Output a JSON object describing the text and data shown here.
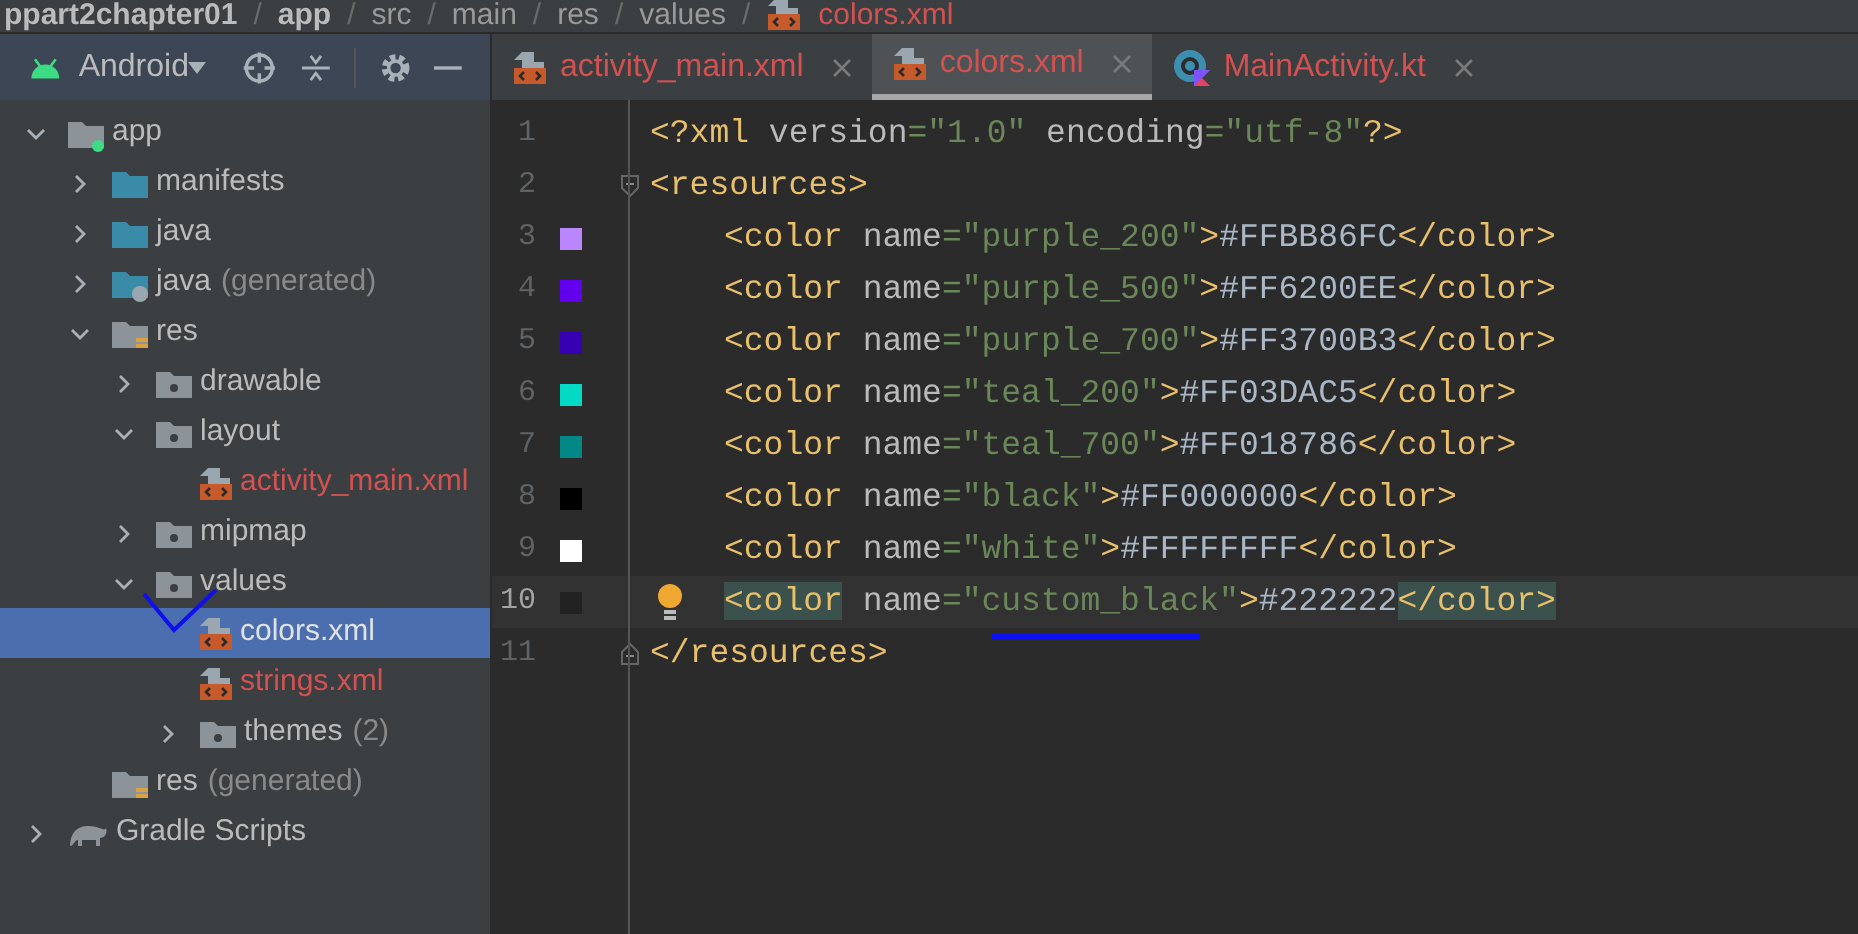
{
  "breadcrumb": [
    {
      "kind": "bold",
      "text": "ppart2chapter01"
    },
    {
      "kind": "separator",
      "text": "/"
    },
    {
      "kind": "bold",
      "text": "app"
    },
    {
      "kind": "separator",
      "text": "/"
    },
    {
      "kind": "plain",
      "text": "src"
    },
    {
      "kind": "separator",
      "text": "/"
    },
    {
      "kind": "plain",
      "text": "main"
    },
    {
      "kind": "separator",
      "text": "/"
    },
    {
      "kind": "plain",
      "text": "res"
    },
    {
      "kind": "separator",
      "text": "/"
    },
    {
      "kind": "plain",
      "text": "values"
    },
    {
      "kind": "separator",
      "text": "/"
    },
    {
      "kind": "file",
      "text": "colors.xml"
    }
  ],
  "project_panel": {
    "view": "Android"
  },
  "tree": [
    {
      "kind": "module",
      "label": "app",
      "expanded": true,
      "selected": false,
      "children": [
        {
          "kind": "folder",
          "label": "manifests",
          "expanded": false,
          "selected": false
        },
        {
          "kind": "folder",
          "label": "java",
          "expanded": false,
          "selected": false
        },
        {
          "kind": "generated-folder",
          "label": "java",
          "suffix": "(generated)",
          "expanded": false,
          "selected": false
        },
        {
          "kind": "res-folder",
          "label": "res",
          "expanded": true,
          "selected": false,
          "children": [
            {
              "kind": "subfolder",
              "label": "drawable",
              "expanded": false,
              "selected": false
            },
            {
              "kind": "subfolder",
              "label": "layout",
              "expanded": true,
              "selected": false,
              "children": [
                {
                  "kind": "xml-file",
                  "label": "activity_main.xml",
                  "selected": false
                }
              ]
            },
            {
              "kind": "subfolder",
              "label": "mipmap",
              "expanded": false,
              "selected": false
            },
            {
              "kind": "subfolder",
              "label": "values",
              "expanded": true,
              "selected": false,
              "children": [
                {
                  "kind": "xml-file",
                  "label": "colors.xml",
                  "selected": true
                },
                {
                  "kind": "xml-file",
                  "label": "strings.xml",
                  "selected": false
                },
                {
                  "kind": "subfolder",
                  "label": "themes",
                  "suffix": "(2)",
                  "expanded": false,
                  "selected": false
                }
              ]
            }
          ]
        },
        {
          "kind": "res-folder",
          "label": "res",
          "suffix": "(generated)",
          "selected": false
        }
      ]
    },
    {
      "kind": "gradle",
      "label": "Gradle Scripts",
      "expanded": false,
      "selected": false
    }
  ],
  "tabs": [
    {
      "kind": "xml",
      "label": "activity_main.xml",
      "selected": false
    },
    {
      "kind": "xml",
      "label": "colors.xml",
      "selected": true
    },
    {
      "kind": "kotlin",
      "label": "MainActivity.kt",
      "selected": false
    }
  ],
  "lines": [
    {
      "number": "1",
      "kind": "plain",
      "indent": false,
      "current": false,
      "tokens": [
        {
          "kind": "tag",
          "t": "<?xml"
        },
        {
          "kind": "attr",
          "t": " version"
        },
        {
          "kind": "str",
          "t": "=\"1.0\""
        },
        {
          "kind": "attr",
          "t": " encoding"
        },
        {
          "kind": "str",
          "t": "=\"utf-8\""
        },
        {
          "kind": "tag",
          "t": "?>"
        }
      ]
    },
    {
      "number": "2",
      "kind": "fold-start",
      "indent": false,
      "current": false,
      "tokens": [
        {
          "kind": "tag",
          "t": "<resources>"
        }
      ]
    },
    {
      "number": "3",
      "kind": "plain",
      "indent": true,
      "current": false,
      "color": "#bb86fc",
      "tokens": [
        {
          "kind": "tag",
          "t": "<color"
        },
        {
          "kind": "attr",
          "t": " name"
        },
        {
          "kind": "str",
          "t": "=\"purple_200\""
        },
        {
          "kind": "tag",
          "t": ">"
        },
        {
          "kind": "text",
          "t": "#FFBB86FC"
        },
        {
          "kind": "tag",
          "t": "</color>"
        }
      ]
    },
    {
      "number": "4",
      "kind": "plain",
      "indent": true,
      "current": false,
      "color": "#6200ee",
      "tokens": [
        {
          "kind": "tag",
          "t": "<color"
        },
        {
          "kind": "attr",
          "t": " name"
        },
        {
          "kind": "str",
          "t": "=\"purple_500\""
        },
        {
          "kind": "tag",
          "t": ">"
        },
        {
          "kind": "text",
          "t": "#FF6200EE"
        },
        {
          "kind": "tag",
          "t": "</color>"
        }
      ]
    },
    {
      "number": "5",
      "kind": "plain",
      "indent": true,
      "current": false,
      "color": "#3700b3",
      "tokens": [
        {
          "kind": "tag",
          "t": "<color"
        },
        {
          "kind": "attr",
          "t": " name"
        },
        {
          "kind": "str",
          "t": "=\"purple_700\""
        },
        {
          "kind": "tag",
          "t": ">"
        },
        {
          "kind": "text",
          "t": "#FF3700B3"
        },
        {
          "kind": "tag",
          "t": "</color>"
        }
      ]
    },
    {
      "number": "6",
      "kind": "plain",
      "indent": true,
      "current": false,
      "color": "#03dac5",
      "tokens": [
        {
          "kind": "tag",
          "t": "<color"
        },
        {
          "kind": "attr",
          "t": " name"
        },
        {
          "kind": "str",
          "t": "=\"teal_200\""
        },
        {
          "kind": "tag",
          "t": ">"
        },
        {
          "kind": "text",
          "t": "#FF03DAC5"
        },
        {
          "kind": "tag",
          "t": "</color>"
        }
      ]
    },
    {
      "number": "7",
      "kind": "plain",
      "indent": true,
      "current": false,
      "color": "#018786",
      "tokens": [
        {
          "kind": "tag",
          "t": "<color"
        },
        {
          "kind": "attr",
          "t": " name"
        },
        {
          "kind": "str",
          "t": "=\"teal_700\""
        },
        {
          "kind": "tag",
          "t": ">"
        },
        {
          "kind": "text",
          "t": "#FF018786"
        },
        {
          "kind": "tag",
          "t": "</color>"
        }
      ]
    },
    {
      "number": "8",
      "kind": "plain",
      "indent": true,
      "current": false,
      "color": "#000000",
      "tokens": [
        {
          "kind": "tag",
          "t": "<color"
        },
        {
          "kind": "attr",
          "t": " name"
        },
        {
          "kind": "str",
          "t": "=\"black\""
        },
        {
          "kind": "tag",
          "t": ">"
        },
        {
          "kind": "text",
          "t": "#FF000000"
        },
        {
          "kind": "tag",
          "t": "</color>"
        }
      ]
    },
    {
      "number": "9",
      "kind": "plain",
      "indent": true,
      "current": false,
      "color": "#ffffff",
      "tokens": [
        {
          "kind": "tag",
          "t": "<color"
        },
        {
          "kind": "attr",
          "t": " name"
        },
        {
          "kind": "str",
          "t": "=\"white\""
        },
        {
          "kind": "tag",
          "t": ">"
        },
        {
          "kind": "text",
          "t": "#FFFFFFFF"
        },
        {
          "kind": "tag",
          "t": "</color>"
        }
      ]
    },
    {
      "number": "10",
      "kind": "plain",
      "indent": true,
      "current": true,
      "color": "#222222",
      "tokens": [
        {
          "kind": "tag",
          "t": "<color",
          "matched": true
        },
        {
          "kind": "attr",
          "t": " name"
        },
        {
          "kind": "str",
          "t": "=\"custom_black\""
        },
        {
          "kind": "tag",
          "t": ">"
        },
        {
          "kind": "text",
          "t": "#222222"
        },
        {
          "kind": "tag",
          "t": "</color>",
          "matched": true
        }
      ]
    },
    {
      "number": "11",
      "kind": "fold-end",
      "indent": false,
      "current": false,
      "tokens": [
        {
          "kind": "tag",
          "t": "</resources>"
        }
      ]
    }
  ]
}
